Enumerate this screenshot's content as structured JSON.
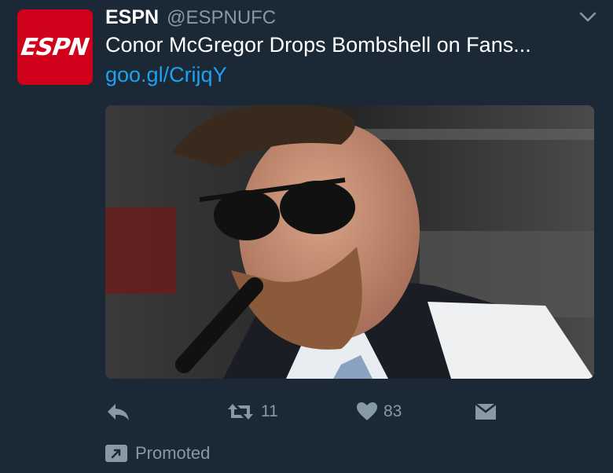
{
  "tweet": {
    "author_name": "ESPN",
    "author_handle": "@ESPNUFC",
    "avatar_text": "ESPN",
    "text": "Conor McGregor Drops Bombshell on Fans...",
    "link": "goo.gl/CrijqY",
    "media_icon": "photo-portrait",
    "actions": {
      "reply_icon": "reply-icon",
      "retweet_icon": "retweet-icon",
      "retweet_count": "11",
      "like_icon": "heart-icon",
      "like_count": "83",
      "dm_icon": "envelope-icon"
    },
    "promoted_label": "Promoted"
  },
  "colors": {
    "background": "#1b2836",
    "link": "#1da1f2",
    "muted": "#8899a6",
    "brand": "#d0021b"
  }
}
